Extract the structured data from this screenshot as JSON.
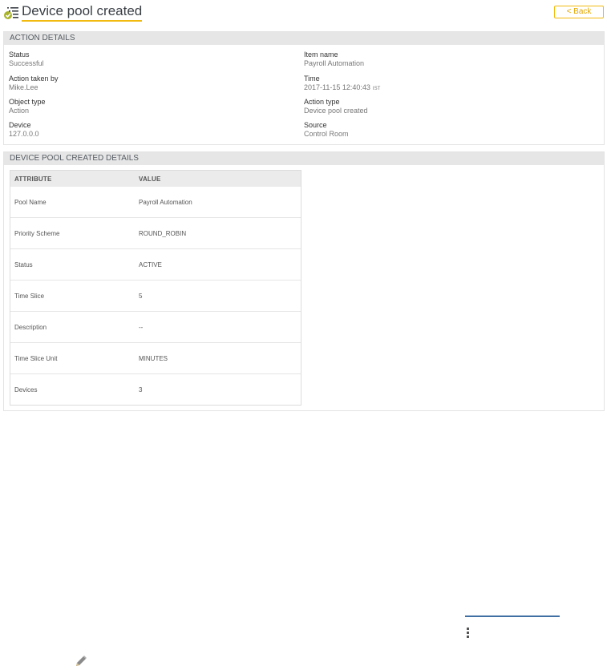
{
  "header": {
    "title": "Device pool created",
    "back_label": "< Back"
  },
  "action_details": {
    "heading": "ACTION DETAILS",
    "left": [
      {
        "label": "Status",
        "value": "Successful"
      },
      {
        "label": "Action taken by",
        "value": "Mike.Lee"
      },
      {
        "label": "Object type",
        "value": "Action"
      },
      {
        "label": "Device",
        "value": "127.0.0.0"
      }
    ],
    "right": [
      {
        "label": "Item name",
        "value": "Payroll Automation"
      },
      {
        "label": "Time",
        "value": "2017-11-15 12:40:43",
        "tz": "IST"
      },
      {
        "label": "Action type",
        "value": "Device pool created"
      },
      {
        "label": "Source",
        "value": "Control Room"
      }
    ]
  },
  "pool_details": {
    "heading": "DEVICE POOL CREATED DETAILS",
    "columns": [
      "ATTRIBUTE",
      "VALUE"
    ],
    "rows": [
      {
        "attribute": "Pool Name",
        "value": "Payroll Automation"
      },
      {
        "attribute": "Priority Scheme",
        "value": "ROUND_ROBIN"
      },
      {
        "attribute": "Status",
        "value": "ACTIVE"
      },
      {
        "attribute": "Time Slice",
        "value": "5"
      },
      {
        "attribute": "Description",
        "value": "--"
      },
      {
        "attribute": "Time Slice Unit",
        "value": "MINUTES"
      },
      {
        "attribute": "Devices",
        "value": "3"
      }
    ]
  },
  "colors": {
    "accent": "#f2b90f",
    "header_bg": "#e6e6e6",
    "link_line": "#3f6fa3"
  },
  "icons": {
    "title": "list-check-icon",
    "kebab": "more-vertical-icon",
    "edit": "pencil-icon"
  }
}
